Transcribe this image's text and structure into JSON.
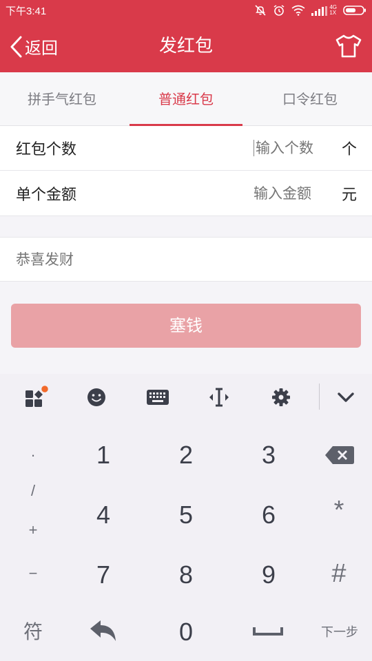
{
  "status_bar": {
    "time": "下午3:41",
    "network": "4G",
    "signal_label": "1X"
  },
  "header": {
    "back_label": "返回",
    "title": "发红包"
  },
  "tabs": [
    {
      "label": "拼手气红包",
      "active": false
    },
    {
      "label": "普通红包",
      "active": true
    },
    {
      "label": "口令红包",
      "active": false
    }
  ],
  "form": {
    "count": {
      "label": "红包个数",
      "placeholder": "输入个数",
      "unit": "个"
    },
    "amount": {
      "label": "单个金额",
      "placeholder": "输入金额",
      "unit": "元"
    },
    "message": {
      "placeholder": "恭喜发财"
    },
    "submit_label": "塞钱"
  },
  "keyboard": {
    "digits": [
      "1",
      "2",
      "3",
      "4",
      "5",
      "6",
      "7",
      "8",
      "9",
      "0"
    ],
    "left_symbols": [
      "·",
      "/",
      "+",
      "−"
    ],
    "star": "*",
    "hash": "#",
    "symbols_key": "符",
    "next_key": "下一步"
  },
  "colors": {
    "brand_red": "#d93a4a",
    "submit_disabled": "#e9a2a6",
    "notification_dot": "#f26a2b"
  }
}
